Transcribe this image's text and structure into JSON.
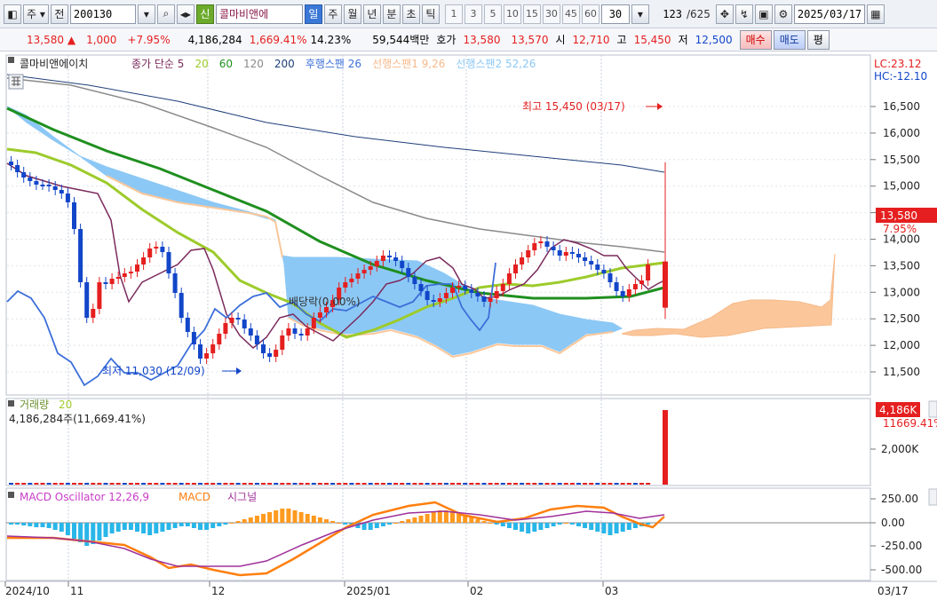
{
  "toolbar": {
    "market": "주",
    "range_btn": "전",
    "code": "200130",
    "shin_badge": "신",
    "stock_name": "콜마비앤에",
    "periods": [
      "일",
      "주",
      "월",
      "년",
      "분",
      "초",
      "틱"
    ],
    "active_period": "일",
    "intervals": [
      "1",
      "3",
      "5",
      "10",
      "15",
      "30",
      "45",
      "60"
    ],
    "interval_select": "30",
    "count": "123",
    "total": "/625",
    "date": "2025/03/17"
  },
  "quote": {
    "price": "13,580",
    "arrow": "▲",
    "change": "1,000",
    "change_pct": "+7.95%",
    "volume": "4,186,284",
    "volume_ratio": "1,669.41%",
    "turnover": "14.23%",
    "amount": "59,544백만",
    "bid_label": "호가",
    "ask_price": "13,580",
    "bid_price": "13,570",
    "open_label": "시",
    "open": "12,710",
    "high_label": "고",
    "high": "15,450",
    "low_label": "저",
    "low": "12,500",
    "buy_btn": "매수",
    "sell_btn": "매도",
    "eval_btn": "평"
  },
  "price_panel": {
    "stock_title": "콜마비앤에이치",
    "legend": [
      {
        "text": "종가 단순 5",
        "color": "#7b2a5c"
      },
      {
        "text": "20",
        "color": "#9dcb2b"
      },
      {
        "text": "60",
        "color": "#1f8f1f"
      },
      {
        "text": "120",
        "color": "#8a8a8a"
      },
      {
        "text": "200",
        "color": "#1e3f7a"
      },
      {
        "text": "후행스팬 26",
        "color": "#3c6fd9"
      },
      {
        "text": "선행스팬1 9,26",
        "color": "#f6b98a"
      },
      {
        "text": "선행스팬2 52,26",
        "color": "#8cc8f5"
      }
    ],
    "lc_label": "LC:23.12",
    "hc_label": "HC:-12.10",
    "y_ticks": [
      "16,500",
      "16,000",
      "15,500",
      "15,000",
      "14,500",
      "14,000",
      "13,500",
      "13,000",
      "12,500",
      "12,000",
      "11,500"
    ],
    "price_tag": "13,580",
    "pct_tag": "7.95%",
    "max_annotation": "최고 15,450 (03/17)",
    "min_annotation": "최저 11,030 (12/09)",
    "dividend_annotation": "배당락(0.00%)"
  },
  "volume_panel": {
    "title": "거래량",
    "ma": "20",
    "info": "4,186,284주(11,669.41%)",
    "tag": "4,186K",
    "tag_pct": "11669.41%",
    "tick": "2,000K"
  },
  "macd_panel": {
    "title": "MACD Oscillator 12,26,9",
    "macd": "MACD",
    "signal": "시그널",
    "ticks": [
      "250.00",
      "0.00",
      "-250.00",
      "-500.00"
    ]
  },
  "x_axis": {
    "labels": [
      "2024/10",
      "11",
      "12",
      "2025/01",
      "02",
      "03"
    ],
    "last_date": "03/17"
  },
  "colors": {
    "up": "#e51f1f",
    "down": "#1246c9",
    "cloud_blue": "#8cc8f5",
    "cloud_orange": "#fbc79a"
  }
}
